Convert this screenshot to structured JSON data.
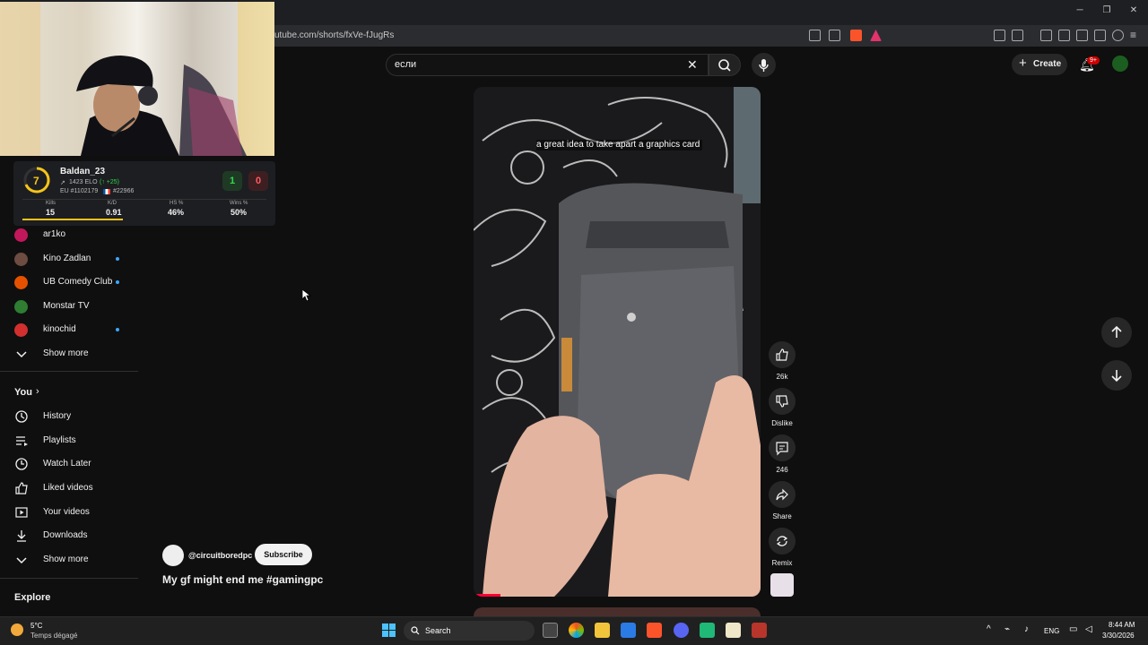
{
  "browser": {
    "url": "utube.com/shorts/fxVe-fJugRs",
    "window_controls": [
      "minimize-icon",
      "restore-icon",
      "close-icon"
    ]
  },
  "header": {
    "search_value": "если",
    "create_label": "Create",
    "notifications_badge": "9+"
  },
  "stream_overlay": {
    "level": "7",
    "player_name": "Baldan_23",
    "elo": "1423 ELO",
    "elo_change": "(↑ +25)",
    "region_rank": "EU #1102179",
    "country_rank": "#22966",
    "wins": "1",
    "losses": "0",
    "stats": [
      {
        "label": "Kills",
        "value": "15"
      },
      {
        "label": "K/D",
        "value": "0.91"
      },
      {
        "label": "HS %",
        "value": "46%"
      },
      {
        "label": "Wins %",
        "value": "50%"
      }
    ]
  },
  "sidebar": {
    "subscriptions": [
      {
        "name": "ar1ko",
        "live": false,
        "color": "#c2185b"
      },
      {
        "name": "Kino Zadlan",
        "live": true,
        "color": "#6d4c41"
      },
      {
        "name": "UB Comedy Club",
        "live": true,
        "color": "#e65100"
      },
      {
        "name": "Monstar TV",
        "live": false,
        "color": "#2e7d32"
      },
      {
        "name": "kinochid",
        "live": true,
        "color": "#d32f2f"
      }
    ],
    "show_more": "Show more",
    "you_heading": "You",
    "you_items": [
      {
        "label": "History",
        "icon": "history-icon"
      },
      {
        "label": "Playlists",
        "icon": "playlists-icon"
      },
      {
        "label": "Watch Later",
        "icon": "clock-icon"
      },
      {
        "label": "Liked videos",
        "icon": "thumb-up-icon"
      },
      {
        "label": "Your videos",
        "icon": "video-icon"
      },
      {
        "label": "Downloads",
        "icon": "download-icon"
      }
    ],
    "show_more_2": "Show more",
    "explore_heading": "Explore"
  },
  "short": {
    "caption": "a great idea to take apart a graphics card",
    "channel": "@circuitboredpc",
    "subscribe": "Subscribe",
    "title": "My gf might end me #gamingpc",
    "likes": "26k",
    "dislike": "Dislike",
    "comments": "246",
    "share": "Share",
    "remix": "Remix"
  },
  "taskbar": {
    "weather_temp": "5°C",
    "weather_desc": "Temps dégagé",
    "search_label": "Search",
    "language": "ENG",
    "time": "8:44 AM",
    "date": "3/30/2026"
  }
}
